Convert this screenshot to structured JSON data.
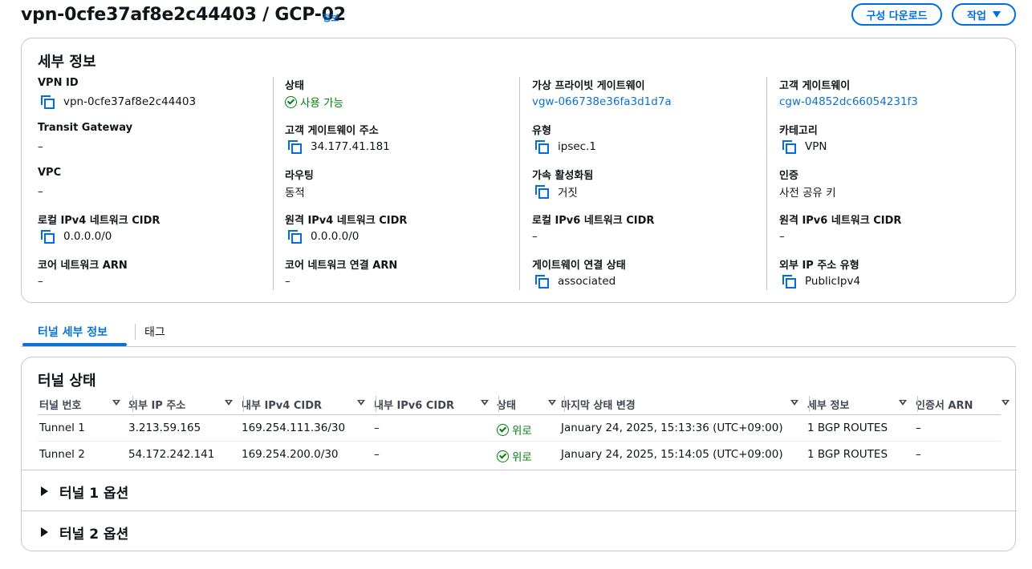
{
  "header": {
    "title": "vpn-0cfe37af8e2c44403 / GCP-02",
    "info_link": "정보",
    "download_button": "구성 다운로드",
    "action_button": "작업"
  },
  "details": {
    "title": "세부 정보",
    "columns": [
      [
        {
          "label": "VPN ID",
          "value": "vpn-0cfe37af8e2c44403",
          "copy": true
        },
        {
          "label": "Transit Gateway",
          "value": "–"
        },
        {
          "label": "VPC",
          "value": "–"
        },
        {
          "label": "로컬 IPv4 네트워크 CIDR",
          "value": "0.0.0.0/0",
          "copy": true
        },
        {
          "label": "코어 네트워크 ARN",
          "value": "–"
        }
      ],
      [
        {
          "label": "상태",
          "value": "사용 가능",
          "status": "success"
        },
        {
          "label": "고객 게이트웨이 주소",
          "value": "34.177.41.181",
          "copy": true
        },
        {
          "label": "라우팅",
          "value": "동적"
        },
        {
          "label": "원격 IPv4 네트워크 CIDR",
          "value": "0.0.0.0/0",
          "copy": true
        },
        {
          "label": "코어 네트워크 연결 ARN",
          "value": "–"
        }
      ],
      [
        {
          "label": "가상 프라이빗 게이트웨이",
          "value": "vgw-066738e36fa3d1d7a",
          "link": true
        },
        {
          "label": "유형",
          "value": "ipsec.1",
          "copy": true
        },
        {
          "label": "가속 활성화됨",
          "value": "거짓",
          "copy": true
        },
        {
          "label": "로컬 IPv6 네트워크 CIDR",
          "value": "–"
        },
        {
          "label": "게이트웨이 연결 상태",
          "value": "associated",
          "copy": true
        }
      ],
      [
        {
          "label": "고객 게이트웨이",
          "value": "cgw-04852dc66054231f3",
          "link": true
        },
        {
          "label": "카테고리",
          "value": "VPN",
          "copy": true
        },
        {
          "label": "인증",
          "value": "사전 공유 키"
        },
        {
          "label": "원격 IPv6 네트워크 CIDR",
          "value": "–"
        },
        {
          "label": "외부 IP 주소 유형",
          "value": "PublicIpv4",
          "copy": true
        }
      ]
    ]
  },
  "tabs": {
    "active": "터널 세부 정보",
    "other": "태그"
  },
  "tunnels": {
    "title": "터널 상태",
    "columns": [
      "터널 번호",
      "외부 IP 주소",
      "내부 IPv4 CIDR",
      "내부 IPv6 CIDR",
      "상태",
      "마지막 상태 변경",
      "세부 정보",
      "인증서 ARN"
    ],
    "rows": [
      [
        "Tunnel 1",
        "3.213.59.165",
        "169.254.111.36/30",
        "–",
        "위로",
        "January 24, 2025, 15:13:36 (UTC+09:00)",
        "1 BGP ROUTES",
        "–"
      ],
      [
        "Tunnel 2",
        "54.172.242.141",
        "169.254.200.0/30",
        "–",
        "위로",
        "January 24, 2025, 15:14:05 (UTC+09:00)",
        "1 BGP ROUTES",
        "–"
      ]
    ],
    "options": [
      "터널 1 옵션",
      "터널 2 옵션"
    ]
  }
}
